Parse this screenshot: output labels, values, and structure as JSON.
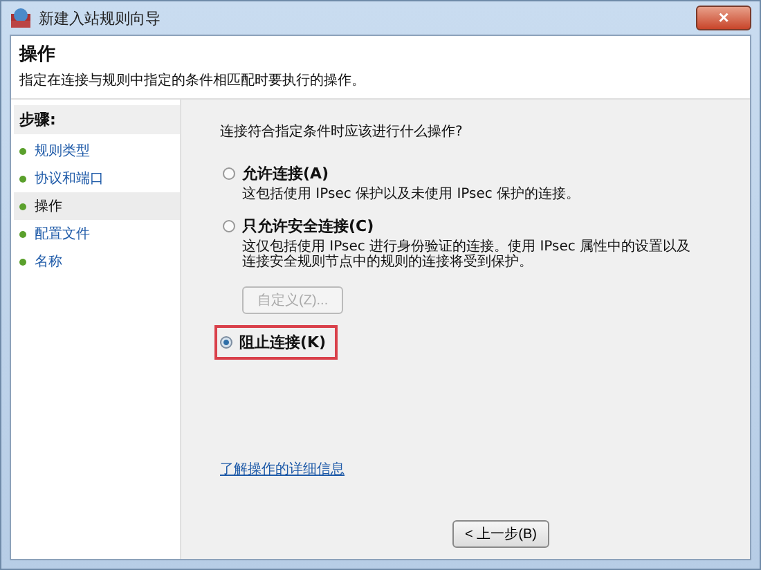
{
  "window": {
    "title": "新建入站规则向导",
    "close": "×"
  },
  "header": {
    "title": "操作",
    "subtitle": "指定在连接与规则中指定的条件相匹配时要执行的操作。"
  },
  "steps": {
    "heading": "步骤:",
    "items": [
      {
        "label": "规则类型",
        "selected": false
      },
      {
        "label": "协议和端口",
        "selected": false
      },
      {
        "label": "操作",
        "selected": true
      },
      {
        "label": "配置文件",
        "selected": false
      },
      {
        "label": "名称",
        "selected": false
      }
    ]
  },
  "question": "连接符合指定条件时应该进行什么操作?",
  "options": [
    {
      "label": "允许连接(A)",
      "description": "这包括使用 IPsec 保护以及未使用 IPsec 保护的连接。",
      "selected": false,
      "highlighted": false
    },
    {
      "label": "只允许安全连接(C)",
      "description": "这仅包括使用 IPsec 进行身份验证的连接。使用 IPsec 属性中的设置以及连接安全规则节点中的规则的连接将受到保护。",
      "selected": false,
      "highlighted": false,
      "button": {
        "label": "自定义(Z)...",
        "disabled": true
      }
    },
    {
      "label": "阻止连接(K)",
      "selected": true,
      "highlighted": true
    }
  ],
  "help_link": "了解操作的详细信息",
  "buttons": {
    "back": "< 上一步(B)"
  }
}
